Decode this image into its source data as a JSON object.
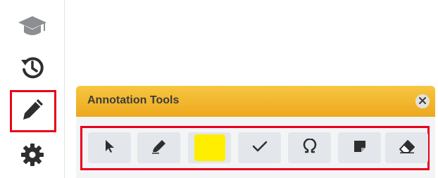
{
  "sidebar": {
    "items": [
      {
        "icon": "graduation-cap-icon"
      },
      {
        "icon": "history-icon"
      },
      {
        "icon": "pen-icon",
        "highlighted": true
      },
      {
        "icon": "gear-icon"
      }
    ]
  },
  "panel": {
    "title": "Annotation Tools",
    "close_icon": "close-icon",
    "tools": [
      {
        "name": "select",
        "icon": "pointer-icon"
      },
      {
        "name": "highlighter",
        "icon": "highlighter-icon"
      },
      {
        "name": "color",
        "icon": "color-swatch",
        "color": "#ffee00"
      },
      {
        "name": "checkmark",
        "icon": "checkmark-icon"
      },
      {
        "name": "symbols",
        "icon": "omega-icon"
      },
      {
        "name": "note",
        "icon": "sticky-note-icon"
      },
      {
        "name": "eraser",
        "icon": "eraser-icon"
      }
    ]
  },
  "colors": {
    "header_gradient_top": "#f7c640",
    "header_gradient_bottom": "#eda81e",
    "highlight_border": "#e8001c",
    "icon_dark": "#2e2e2e",
    "icon_muted": "#8c8e92"
  }
}
